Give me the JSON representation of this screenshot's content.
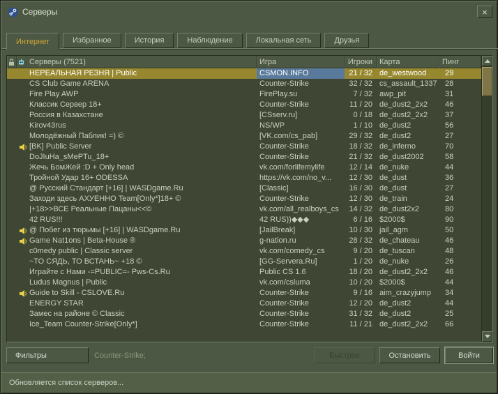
{
  "window": {
    "title": "Серверы"
  },
  "icons": {
    "close": "×"
  },
  "tabs": {
    "items": [
      {
        "label": "Интернет",
        "active": true
      },
      {
        "label": "Избранное",
        "active": false
      },
      {
        "label": "История",
        "active": false
      },
      {
        "label": "Наблюдение",
        "active": false
      },
      {
        "label": "Локальная сеть",
        "active": false
      },
      {
        "label": "Друзья",
        "active": false
      }
    ]
  },
  "server_list": {
    "columns": {
      "servers": "Серверы (7521)",
      "game": "Игра",
      "players": "Игроки",
      "map": "Карта",
      "ping": "Пинг"
    },
    "rows": [
      {
        "icon": "",
        "name": "НЕРЕАЛЬНАЯ РЕЗНЯ | Public",
        "game": "CSMON.INFO",
        "players": "21 / 32",
        "map": "de_westwood",
        "ping": "29",
        "selected": true
      },
      {
        "icon": "",
        "name": "CS Club Game ARENA",
        "game": "Counter-Strike",
        "players": "32 / 32",
        "map": "cs_assault_1337",
        "ping": "28",
        "selected": false
      },
      {
        "icon": "",
        "name": "Fire Play AWP",
        "game": "FirePlay.su",
        "players": "7 / 32",
        "map": "awp_pit",
        "ping": "31",
        "selected": false
      },
      {
        "icon": "",
        "name": "Классик Сервер 18+",
        "game": "Counter-Strike",
        "players": "11 / 20",
        "map": "de_dust2_2x2",
        "ping": "46",
        "selected": false
      },
      {
        "icon": "",
        "name": "Россия в Казахстане",
        "game": "[CSserv.ru]",
        "players": "0 / 18",
        "map": "de_dust2_2x2",
        "ping": "37",
        "selected": false
      },
      {
        "icon": "",
        "name": "Kirov43rus",
        "game": "NS/WP",
        "players": "1 / 10",
        "map": "de_dust2",
        "ping": "56",
        "selected": false
      },
      {
        "icon": "",
        "name": "Молодёжный Паблик! =) ©",
        "game": "[VK.com/cs_pab]",
        "players": "29 / 32",
        "map": "de_dust2",
        "ping": "27",
        "selected": false
      },
      {
        "icon": "speaker",
        "name": "[BK] Public Server",
        "game": "Counter-Strike",
        "players": "18 / 32",
        "map": "de_inferno",
        "ping": "70",
        "selected": false
      },
      {
        "icon": "",
        "name": "DoJIuHa_sMePTu_18+",
        "game": "Counter-Strike",
        "players": "21 / 32",
        "map": "de_dust2002",
        "ping": "58",
        "selected": false
      },
      {
        "icon": "",
        "name": "Жечь БомЖей :D + Only head",
        "game": "vk.com/forlifemylife",
        "players": "12 / 14",
        "map": "de_nuke",
        "ping": "44",
        "selected": false
      },
      {
        "icon": "",
        "name": "Тройной Удар 16+ ODESSA",
        "game": "https://vk.com/no_v...",
        "players": "12 / 30",
        "map": "de_dust",
        "ping": "36",
        "selected": false
      },
      {
        "icon": "",
        "name": "@ Русский Стандарт [+16] | WASDgame.Ru",
        "game": "[Classic]",
        "players": "16 / 30",
        "map": "de_dust",
        "ping": "27",
        "selected": false
      },
      {
        "icon": "",
        "name": "Заходи здесь АХУЕННО Team[Only*]18+ ©",
        "game": "Counter-Strike",
        "players": "12 / 30",
        "map": "de_train",
        "ping": "24",
        "selected": false
      },
      {
        "icon": "",
        "name": "|+18>>ВСЕ Реальные Пацаны<<©",
        "game": "vk.com/all_realboys_cs",
        "players": "14 / 32",
        "map": "de_dust2x2",
        "ping": "80",
        "selected": false
      },
      {
        "icon": "",
        "name": "42 RUS!!!",
        "game": "42 RUS))◆◆◆",
        "players": "6 / 16",
        "map": "$2000$",
        "ping": "90",
        "selected": false
      },
      {
        "icon": "speaker",
        "name": "@ Побег из тюрьмы [+16] | WASDgame.Ru",
        "game": "[JailBreak]",
        "players": "10 / 30",
        "map": "jail_agm",
        "ping": "50",
        "selected": false
      },
      {
        "icon": "speaker",
        "name": "Game Nat1ons | Beta-House ®",
        "game": "g-nation.ru",
        "players": "28 / 32",
        "map": "de_chateau",
        "ping": "46",
        "selected": false
      },
      {
        "icon": "",
        "name": "c0medy public | Classic server",
        "game": "vk.com/comedy_cs",
        "players": "9 / 20",
        "map": "de_tuscan",
        "ping": "48",
        "selected": false
      },
      {
        "icon": "",
        "name": "~ТО СЯДЬ, ТО ВСТАНЬ~ +18 ©",
        "game": "[GG-Servera.Ru]",
        "players": "1 / 20",
        "map": "de_nuke",
        "ping": "26",
        "selected": false
      },
      {
        "icon": "",
        "name": "Играйте с Нами -=PUBLIC=- Pws-Cs.Ru",
        "game": "Public CS 1.6",
        "players": "18 / 20",
        "map": "de_dust2_2x2",
        "ping": "46",
        "selected": false
      },
      {
        "icon": "",
        "name": "Ludus Magnus | Public",
        "game": "vk.com/csluma",
        "players": "10 / 20",
        "map": "$2000$",
        "ping": "44",
        "selected": false
      },
      {
        "icon": "speaker",
        "name": "Guide to Skill - CSLOVE.Ru",
        "game": "Counter-Strike",
        "players": "9 / 16",
        "map": "aim_crazyjump",
        "ping": "34",
        "selected": false
      },
      {
        "icon": "",
        "name": "ENERGY STAR",
        "game": "Counter-Strike",
        "players": "12 / 20",
        "map": "de_dust2",
        "ping": "44",
        "selected": false
      },
      {
        "icon": "",
        "name": "Замес на районе © Classic",
        "game": "Counter-Strike",
        "players": "31 / 32",
        "map": "de_dust2",
        "ping": "25",
        "selected": false
      },
      {
        "icon": "",
        "name": "Ice_Team Counter-Strike[Only*]",
        "game": "Counter-Strike",
        "players": "11 / 21",
        "map": "de_dust2_2x2",
        "ping": "66",
        "selected": false
      }
    ]
  },
  "footer": {
    "filters_button": "Фильтры",
    "filter_summary": "Counter-Strike;",
    "quick_button": "Быстрое",
    "stop_button": "Остановить",
    "join_button": "Войти"
  },
  "status_bar": {
    "text": "Обновляется список серверов..."
  },
  "colors": {
    "window_bg": "#4C5844",
    "list_bg": "#3F4734",
    "selected_row": "#97882F",
    "selected_game_cell": "#5A7A9C",
    "active_tab_text": "#CEA334"
  }
}
